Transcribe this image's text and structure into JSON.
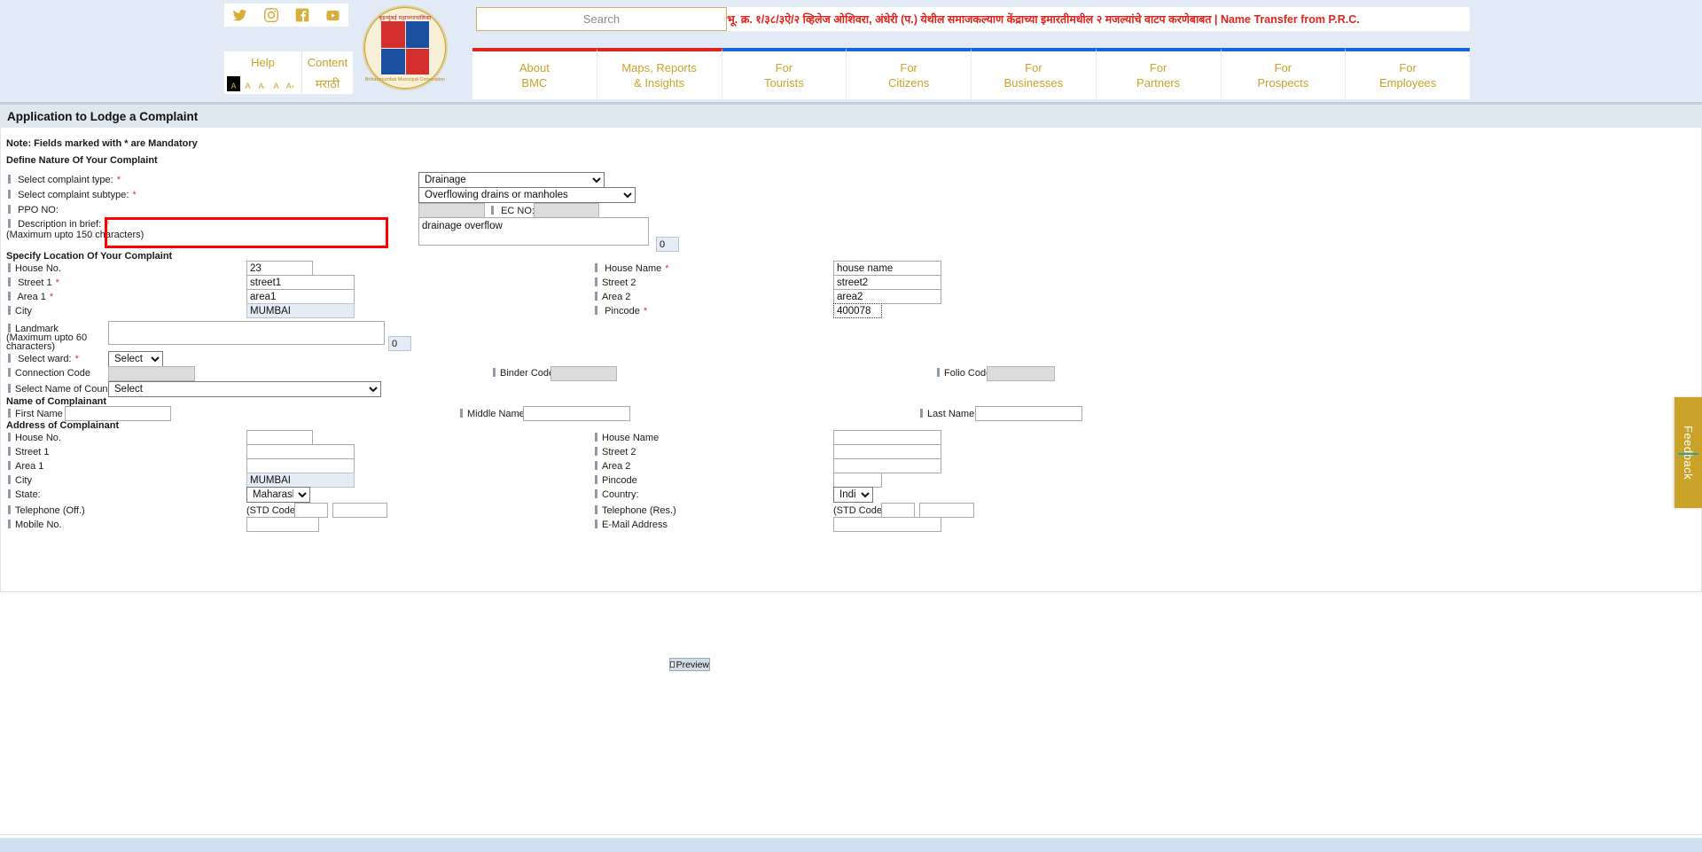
{
  "header": {
    "social": [
      {
        "name": "twitter-icon",
        "label": "Twitter"
      },
      {
        "name": "instagram-icon",
        "label": "Instagram"
      },
      {
        "name": "facebook-icon",
        "label": "Facebook"
      },
      {
        "name": "youtube-icon",
        "label": "YouTube"
      }
    ],
    "help_label": "Help",
    "content_label": "Content",
    "marathi_label": "मराठी",
    "font_sizes": [
      "A",
      "A",
      "A",
      "A",
      "A"
    ],
    "logo_top_text": "बृहन्मुंबई महानगरपालिका",
    "logo_bottom_text": "Brihanmumbai Municipal Corporation",
    "search_placeholder": "Search",
    "search_value": "",
    "ticker_text": "भू. क्र. १/३८/३ऐ/२ व्हिलेज ओशिवरा, अंधेरी (प.) येथील समाजकल्याण केंद्राच्या इमारतीमधील २ मजल्यांचे वाटप करणेबाबत | Name Transfer from P.R.C.",
    "nav": [
      {
        "line1": "About",
        "line2": "BMC",
        "accent": "#e0241b"
      },
      {
        "line1": "Maps, Reports",
        "line2": "& Insights",
        "accent": "#e0241b"
      },
      {
        "line1": "For",
        "line2": "Tourists",
        "accent": "#1565d8"
      },
      {
        "line1": "For",
        "line2": "Citizens",
        "accent": "#1565d8"
      },
      {
        "line1": "For",
        "line2": "Businesses",
        "accent": "#1565d8"
      },
      {
        "line1": "For",
        "line2": "Partners",
        "accent": "#1565d8"
      },
      {
        "line1": "For",
        "line2": "Prospects",
        "accent": "#1565d8"
      },
      {
        "line1": "For",
        "line2": "Employees",
        "accent": "#1565d8"
      }
    ]
  },
  "page": {
    "title": "Application to Lodge a Complaint",
    "note": "Note: Fields marked with * are Mandatory",
    "section_nature": "Define Nature Of Your Complaint",
    "section_location": "Specify Location Of Your Complaint",
    "section_name": "Name of Complainant",
    "section_address": "Address of Complainant",
    "preview_label": "Preview",
    "feedback_label": "Feedback"
  },
  "nature": {
    "complaint_type_label": "Select complaint type:",
    "complaint_type_value": "Drainage",
    "complaint_subtype_label": "Select complaint subtype:",
    "complaint_subtype_value": "Overflowing drains or manholes",
    "ppo_label": "PPO NO:",
    "ppo_value": "",
    "ec_label": "EC NO:",
    "ec_value": "",
    "description_label": "Description in brief:",
    "description_hint": "(Maximum upto 150 characters)",
    "description_value": "drainage overflow",
    "description_counter": "0"
  },
  "location": {
    "house_no_label": "House No.",
    "house_no_value": "23",
    "house_name_label": "House Name",
    "house_name_value": "house name",
    "street1_label": "Street 1",
    "street1_value": "street1",
    "street2_label": "Street 2",
    "street2_value": "street2",
    "area1_label": "Area 1",
    "area1_value": "area1",
    "area2_label": "Area 2",
    "area2_value": "area2",
    "city_label": "City",
    "city_value": "MUMBAI",
    "pincode_label": "Pincode",
    "pincode_value": "400078",
    "landmark_label": "Landmark",
    "landmark_hint1": "(Maximum upto 60",
    "landmark_hint2": "characters)",
    "landmark_value": "",
    "landmark_counter": "0",
    "ward_label": "Select ward:",
    "ward_value": "Select",
    "binder_label": "Binder Code",
    "binder_value": "",
    "folio_label": "Folio Code",
    "folio_value": "",
    "connection_label": "Connection Code",
    "connection_value": "",
    "council_label": "Select Name of Council:",
    "council_value": "Select"
  },
  "complainant": {
    "first_name_label": "First Name",
    "first_name_value": "",
    "middle_name_label": "Middle Name",
    "middle_name_value": "",
    "last_name_label": "Last Name",
    "last_name_value": "",
    "house_no_label": "House No.",
    "house_no_value": "",
    "house_name_label": "House Name",
    "house_name_value": "",
    "street1_label": "Street 1",
    "street1_value": "",
    "street2_label": "Street 2",
    "street2_value": "",
    "area1_label": "Area 1",
    "area1_value": "",
    "area2_label": "Area 2",
    "area2_value": "",
    "city_label": "City",
    "city_value": "MUMBAI",
    "pincode_label": "Pincode",
    "pincode_value": "",
    "state_label": "State:",
    "state_value": "Maharashtra",
    "country_label": "Country:",
    "country_value": "India",
    "tel_off_label": "Telephone (Off.)",
    "tel_off_std_label": "(STD Code)",
    "tel_off_std_value": "",
    "tel_off_value": "",
    "tel_res_label": "Telephone (Res.)",
    "tel_res_std_label": "(STD Code)",
    "tel_res_std_value": "",
    "tel_res_value": "",
    "mobile_label": "Mobile No.",
    "mobile_value": "",
    "email_label": "E-Mail Address",
    "email_value": ""
  }
}
